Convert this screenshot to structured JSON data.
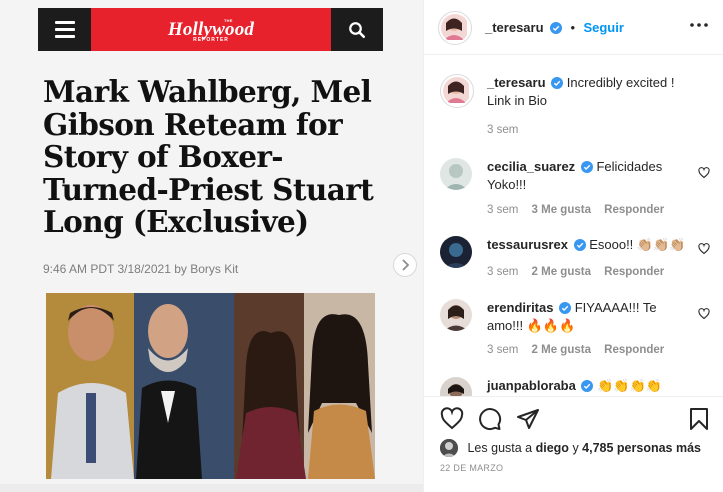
{
  "article": {
    "brand_the": "THE",
    "brand": "Hollywood",
    "brand_sub": "REPORTER",
    "headline": "Mark Wahlberg, Mel Gibson Reteam for Story of Boxer-Turned-Priest Stuart Long (Exclusive)",
    "byline": "9:46 AM PDT 3/18/2021 by Borys Kit"
  },
  "post": {
    "username": "_teresaru",
    "follow_label": "Seguir",
    "dot": "•",
    "caption_text": "Incredibly excited ! Link in Bio",
    "caption_time": "3 sem"
  },
  "comments": [
    {
      "username": "cecilia_suarez",
      "text": "Felicidades Yoko!!!",
      "time": "3 sem",
      "likes": "3 Me gusta",
      "reply": "Responder"
    },
    {
      "username": "tessaurusrex",
      "text": "Esooo!! 👏🏼👏🏼👏🏼",
      "time": "3 sem",
      "likes": "2 Me gusta",
      "reply": "Responder"
    },
    {
      "username": "erendiritas",
      "text": "FIYAAAA!!! Te amo!!! 🔥🔥🔥",
      "time": "3 sem",
      "likes": "2 Me gusta",
      "reply": "Responder"
    },
    {
      "username": "juanpabloraba",
      "text": "👏👏👏👏",
      "time": "",
      "likes": "",
      "reply": ""
    }
  ],
  "likes_line": {
    "prefix": "Les gusta a",
    "user": "diego",
    "middle": "y",
    "count": "4,785 personas más"
  },
  "date": "22 DE MARZO",
  "colors": {
    "accent": "#0095f6",
    "brand_red": "#e8222d",
    "meta_gray": "#8e8e8e"
  }
}
